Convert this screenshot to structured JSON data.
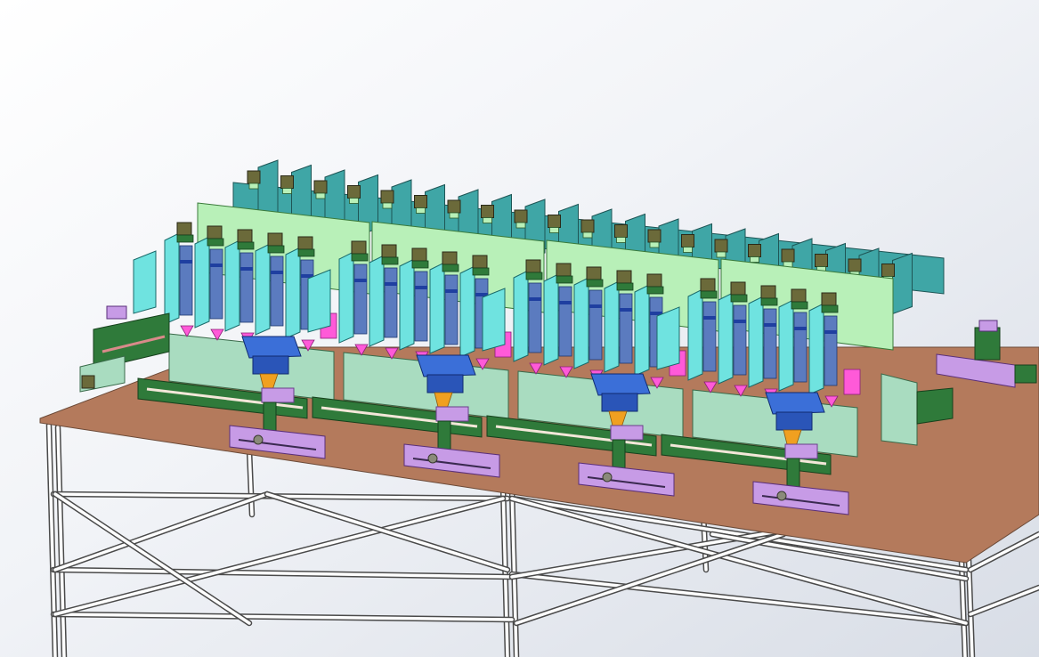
{
  "scene": {
    "subject": "cad-assembly",
    "module_count": 4,
    "top_rail_unit_count": 20,
    "colors": {
      "background_top": "#f4f5f8",
      "background_mid": "#e2e6ee",
      "tabletop": "#b47a5c",
      "frame": "#ffffff",
      "frame_edge": "#4a4a4a",
      "upper_panel": "#3fa6a6",
      "cyan_block": "#6fe3e0",
      "light_green": "#b8f0b8",
      "dark_green": "#2f7a3a",
      "mint_base": "#a9dcc0",
      "motor_olive": "#6b6a3a",
      "magenta": "#ff5ad8",
      "lilac": "#c79be6",
      "blue_unit": "#3b6fd8",
      "orange": "#f0a020",
      "steel_blue": "#5b7bbf"
    }
  }
}
